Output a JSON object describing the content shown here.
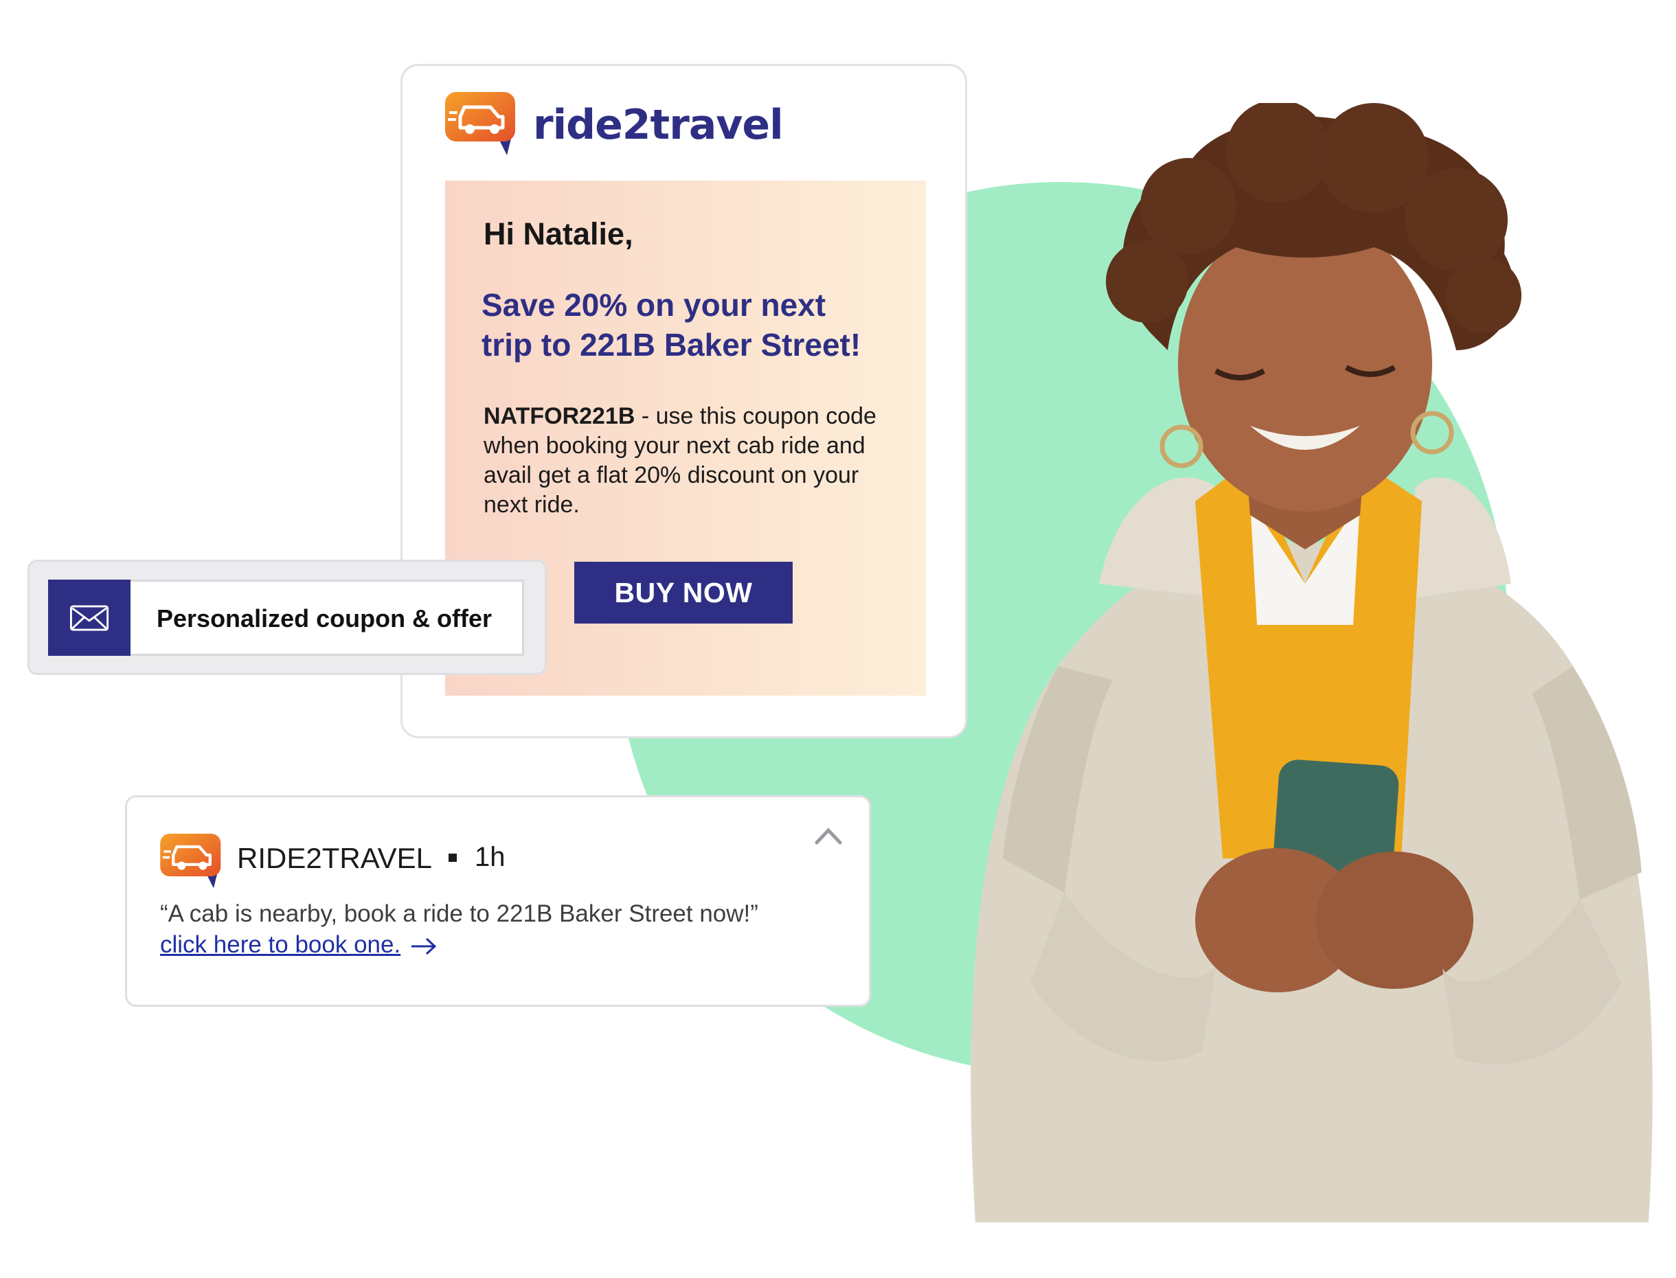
{
  "email": {
    "brand_name": "ride2travel",
    "greeting": "Hi Natalie,",
    "headline_line1": "Save 20% on your next",
    "headline_line2": "trip to 221B Baker Street!",
    "coupon_code": "NATFOR221B",
    "body_text": " - use this coupon code when booking your next cab ride and avail get a flat 20% discount on your next ride.",
    "button_label": "BUY NOW"
  },
  "coupon_card": {
    "label": "Personalized coupon & offer",
    "icon": "mail-icon"
  },
  "notification": {
    "app_name": "RIDE2TRAVEL",
    "time": "1h",
    "message": "“A cab is nearby, book a ride to 221B Baker Street now!”",
    "link_text": "click here to book one.",
    "icons": [
      "app-logo-icon",
      "chevron-up-icon",
      "arrow-right-icon"
    ]
  },
  "colors": {
    "brand_navy": "#2e2f84",
    "logo_orange": "#f0702a",
    "accent_green": "#a2ecc5",
    "link_blue": "#1f2fa3"
  }
}
